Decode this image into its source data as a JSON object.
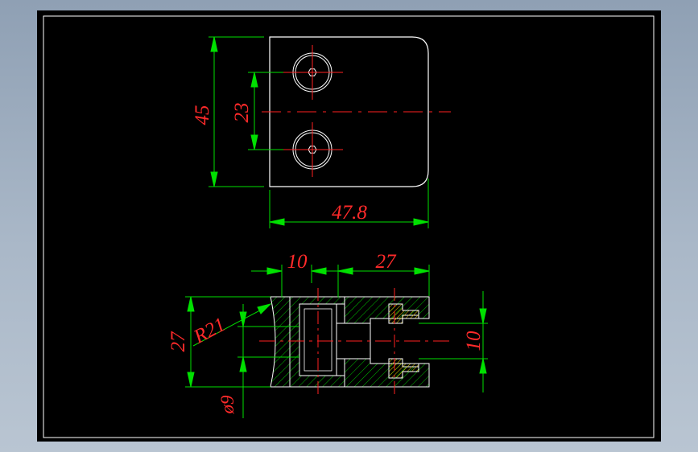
{
  "colors": {
    "background": "#000000",
    "outline": "#ffffff",
    "dimension_text": "#ff2a2a",
    "dimension_lines": "#00e000",
    "centerlines": "#ff2020",
    "hatch": "#00c000",
    "insert_hatch": "#ffe000",
    "window_bg": "#aab8c8"
  },
  "top_view": {
    "dim_height": "45",
    "dim_hole_spacing": "23",
    "dim_width": "47.8"
  },
  "section_view": {
    "dim_left": "10",
    "dim_right": "27",
    "dim_height": "27",
    "dim_radius": "R21",
    "dim_diameter": "ø9",
    "dim_slot": "10"
  }
}
